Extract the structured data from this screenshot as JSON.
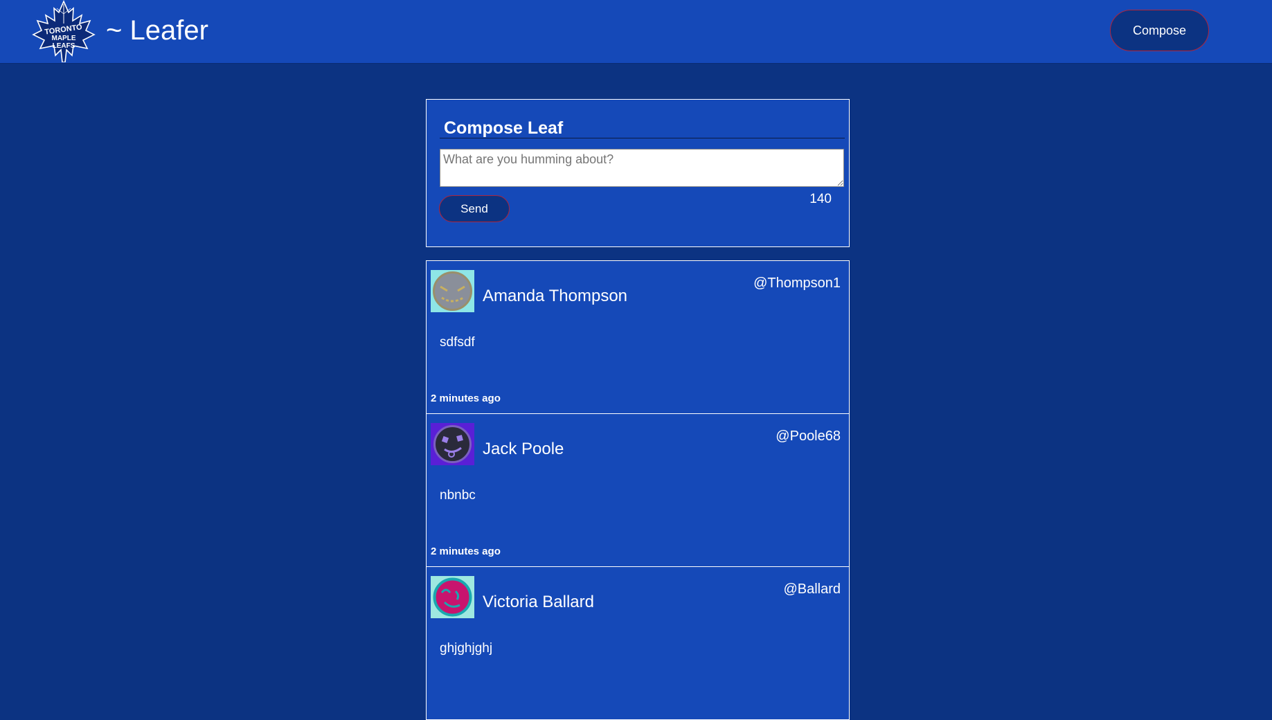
{
  "header": {
    "logo": {
      "icon": "maple-leaf-logo",
      "text_line1": "TORONTO",
      "text_line2": "MAPLE",
      "text_line3": "LEAFS"
    },
    "title": "~ Leafer",
    "compose_button_label": "Compose"
  },
  "composer": {
    "heading": "Compose Leaf",
    "placeholder": "What are you humming about?",
    "value": "",
    "char_count": "140",
    "send_label": "Send"
  },
  "feed": {
    "leaves": [
      {
        "name": "Amanda Thompson",
        "handle": "@Thompson1",
        "body": "sdfsdf",
        "timestamp": "2 minutes ago",
        "avatar": {
          "icon": "avatar-icon",
          "bg": "#8ee6e6",
          "face": "#8a8f9a"
        }
      },
      {
        "name": "Jack Poole",
        "handle": "@Poole68",
        "body": "nbnbc",
        "timestamp": "2 minutes ago",
        "avatar": {
          "icon": "avatar-icon",
          "bg": "#5a1fd6",
          "face": "#2a2a3a"
        }
      },
      {
        "name": "Victoria Ballard",
        "handle": "@Ballard",
        "body": "ghjghjghj",
        "timestamp": "",
        "avatar": {
          "icon": "avatar-icon",
          "bg": "#9ee8e0",
          "face": "#c8146e"
        }
      }
    ]
  },
  "colors": {
    "page_bg": "#0c3382",
    "bar_bg": "#1549b8",
    "button_border": "#b0243a"
  }
}
